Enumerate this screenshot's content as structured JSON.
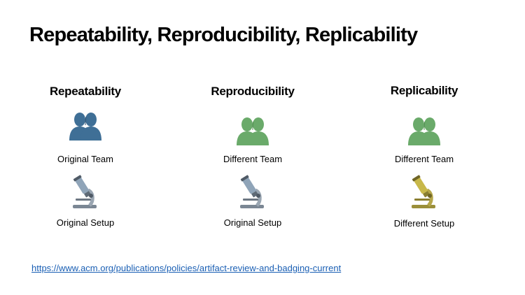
{
  "slide": {
    "title": "Repeatability, Reproducibility, Replicability",
    "link": "https://www.acm.org/publications/policies/artifact-review-and-badging-current"
  },
  "columns": [
    {
      "heading": "Repeatability",
      "team_label": "Original Team",
      "team_icon": "people-icon",
      "team_color": "#3f6f96",
      "setup_label": "Original Setup",
      "setup_icon": "microscope-icon",
      "setup_color": "#8fa4b8"
    },
    {
      "heading": "Reproducibility",
      "team_label": "Different Team",
      "team_icon": "people-icon",
      "team_color": "#6aaa6a",
      "setup_label": "Original Setup",
      "setup_icon": "microscope-icon",
      "setup_color": "#8fa4b8"
    },
    {
      "heading": "Replicability",
      "team_label": "Different Team",
      "team_icon": "people-icon",
      "team_color": "#6aaa6a",
      "setup_label": "Different Setup",
      "setup_icon": "microscope-icon",
      "setup_color": "#c8b84a"
    }
  ]
}
